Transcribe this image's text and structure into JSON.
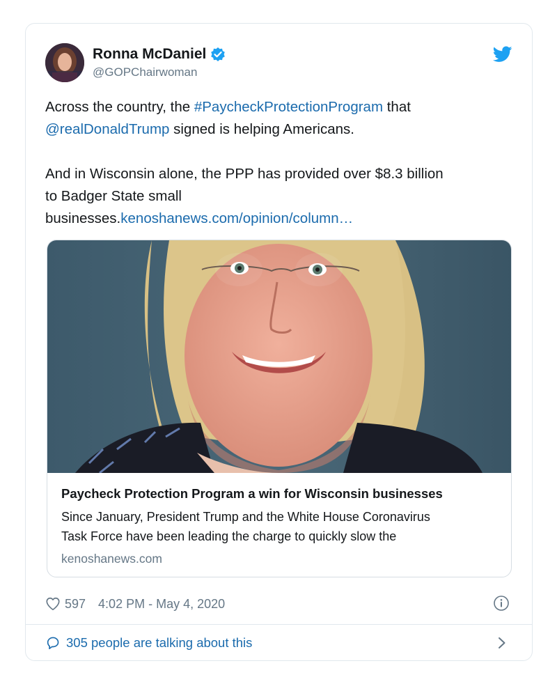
{
  "tweet": {
    "author": {
      "display_name": "Ronna McDaniel",
      "handle": "@GOPChairwoman",
      "verified": true
    },
    "text": {
      "line1_prefix": "Across the country, the ",
      "hashtag": "#PaycheckProtectionProgram",
      "line1_suffix": " that",
      "mention": "@realDonaldTrump",
      "line2_suffix": " signed is helping Americans.",
      "para2_line1": "And in Wisconsin alone, the PPP has provided over $8.3 billion",
      "para2_line2": "to Badger State small",
      "para2_line3_prefix": "businesses.",
      "url": "kenoshanews.com/opinion/column…"
    },
    "link_card": {
      "title": "Paycheck Protection Program a win for Wisconsin businesses",
      "description_line1": "Since January, President Trump and the White House Coronavirus",
      "description_line2": "Task Force have been leading the charge to quickly slow the",
      "domain": "kenoshanews.com"
    },
    "likes": "597",
    "timestamp": "4:02 PM - May 4, 2020",
    "conversation": "305 people are talking about this"
  },
  "icons": {
    "verified": "verified-badge-icon",
    "brand": "twitter-bird-icon",
    "like": "heart-icon",
    "info": "info-icon",
    "reply": "speech-bubble-icon",
    "more": "chevron-right-icon"
  },
  "colors": {
    "link": "#1b6bad",
    "twitter_blue": "#1da1f2",
    "muted": "#657786",
    "border": "#e1e8ed"
  }
}
